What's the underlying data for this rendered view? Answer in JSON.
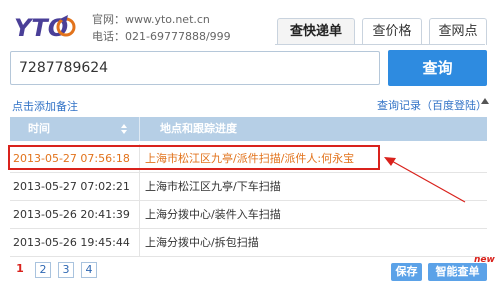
{
  "header": {
    "logo_text": "YTO",
    "website_line": "官网：www.yto.net.cn",
    "phone_line": "电话：021-69777888/999"
  },
  "tabs": [
    {
      "label": "查快递单",
      "active": true
    },
    {
      "label": "查价格",
      "active": false
    },
    {
      "label": "查网点",
      "active": false
    }
  ],
  "search": {
    "value": "7287789624",
    "placeholder": "",
    "button_label": "查询"
  },
  "links": {
    "add_note": "点击添加备注",
    "history": "查询记录（百度登陆）"
  },
  "table": {
    "columns": [
      "时间",
      "地点和跟踪进度"
    ],
    "rows": [
      {
        "time": "2013-05-27 07:56:18",
        "detail": "上海市松江区九亭/派件扫描/派件人:何永宝",
        "highlighted": true
      },
      {
        "time": "2013-05-27 07:02:21",
        "detail": "上海市松江区九亭/下车扫描",
        "highlighted": false
      },
      {
        "time": "2013-05-26 20:41:39",
        "detail": "上海分拨中心/装件入车扫描",
        "highlighted": false
      },
      {
        "time": "2013-05-26 19:45:44",
        "detail": "上海分拨中心/拆包扫描",
        "highlighted": false
      }
    ]
  },
  "pagination": {
    "pages": [
      "1",
      "2",
      "3",
      "4"
    ],
    "current": "1"
  },
  "actions": {
    "save_label": "保存",
    "smart_label": "智能查单",
    "new_badge": "new"
  },
  "colors": {
    "accent_blue": "#2e8be0",
    "header_blue": "#b6cfe6",
    "highlight_orange": "#e2731c",
    "annotation_red": "#d9221c"
  }
}
